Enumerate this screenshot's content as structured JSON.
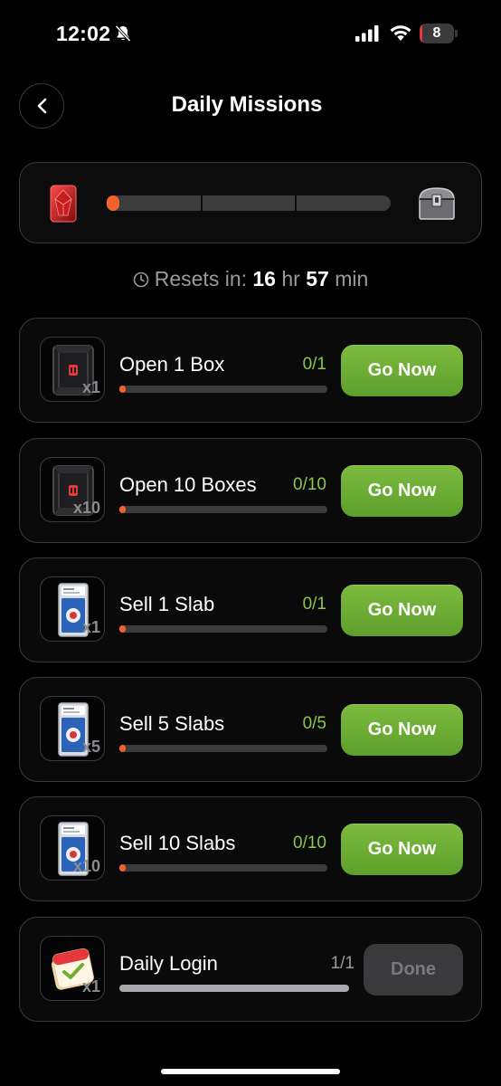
{
  "status_bar": {
    "time": "12:02",
    "battery": "8",
    "battery_level": 0.08
  },
  "header": {
    "title": "Daily Missions"
  },
  "overall_progress": {
    "fraction": 0.03
  },
  "resets": {
    "prefix": "Resets in:",
    "hours": "16",
    "hours_unit": "hr",
    "minutes": "57",
    "minutes_unit": "min"
  },
  "missions": [
    {
      "title": "Open 1 Box",
      "count": "0/1",
      "qty": "x1",
      "icon": "box-icon",
      "progress": 0,
      "button": "Go Now"
    },
    {
      "title": "Open 10 Boxes",
      "count": "0/10",
      "qty": "x10",
      "icon": "box-icon",
      "progress": 0,
      "button": "Go Now"
    },
    {
      "title": "Sell 1 Slab",
      "count": "0/1",
      "qty": "x1",
      "icon": "slab-icon",
      "progress": 0,
      "button": "Go Now"
    },
    {
      "title": "Sell 5 Slabs",
      "count": "0/5",
      "qty": "x5",
      "icon": "slab-icon",
      "progress": 0,
      "button": "Go Now"
    },
    {
      "title": "Sell 10 Slabs",
      "count": "0/10",
      "qty": "x10",
      "icon": "slab-icon",
      "progress": 0,
      "button": "Go Now"
    },
    {
      "title": "Daily Login",
      "count": "1/1",
      "qty": "x1",
      "icon": "calendar-check-icon",
      "progress": 1,
      "button": "Done"
    }
  ],
  "colors": {
    "accent_orange": "#f2622e",
    "go_green": "#6cae34",
    "count_green": "#8ac74a",
    "border": "#3b3b3d"
  }
}
